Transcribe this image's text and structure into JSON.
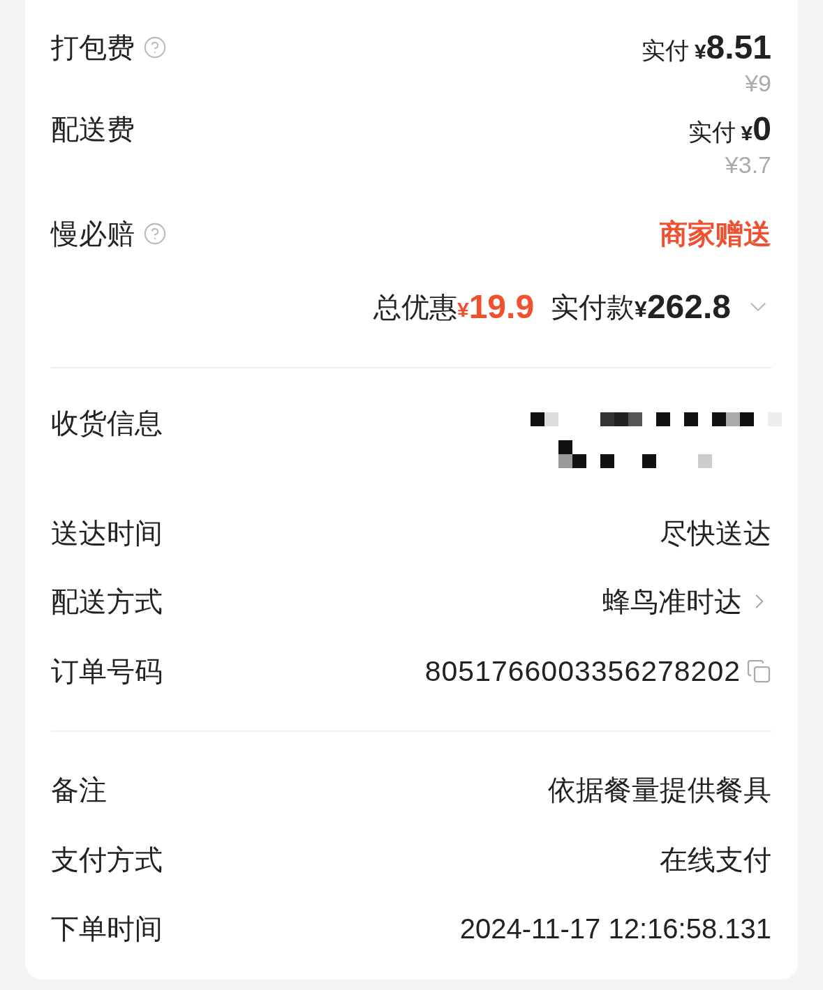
{
  "fees": [
    {
      "label": "打包费",
      "help": true,
      "kind": "price",
      "paid_label": "实付",
      "currency": "¥",
      "amount": "8.51",
      "original": "¥9"
    },
    {
      "label": "配送费",
      "help": false,
      "kind": "price",
      "paid_label": "实付",
      "currency": "¥",
      "amount": "0",
      "original": "¥3.7"
    },
    {
      "label": "慢必赔",
      "help": true,
      "kind": "gift",
      "value": "商家赠送"
    }
  ],
  "summary": {
    "discount_label": "总优惠",
    "discount_currency": "¥",
    "discount": "19.9",
    "total_label": "实付款",
    "total_currency": "¥",
    "total": "262.8",
    "expanded": false
  },
  "delivery": [
    {
      "label": "收货信息",
      "kind": "redacted"
    },
    {
      "label": "送达时间",
      "kind": "text",
      "value": "尽快送达"
    },
    {
      "label": "配送方式",
      "kind": "link",
      "value": "蜂鸟准时达"
    },
    {
      "label": "订单号码",
      "kind": "copy",
      "value": "8051766003356278202"
    }
  ],
  "order": [
    {
      "label": "备注",
      "kind": "text",
      "value": "依据餐量提供餐具"
    },
    {
      "label": "支付方式",
      "kind": "text",
      "value": "在线支付"
    },
    {
      "label": "下单时间",
      "kind": "text",
      "value": "2024-11-17 12:16:58.131"
    }
  ]
}
